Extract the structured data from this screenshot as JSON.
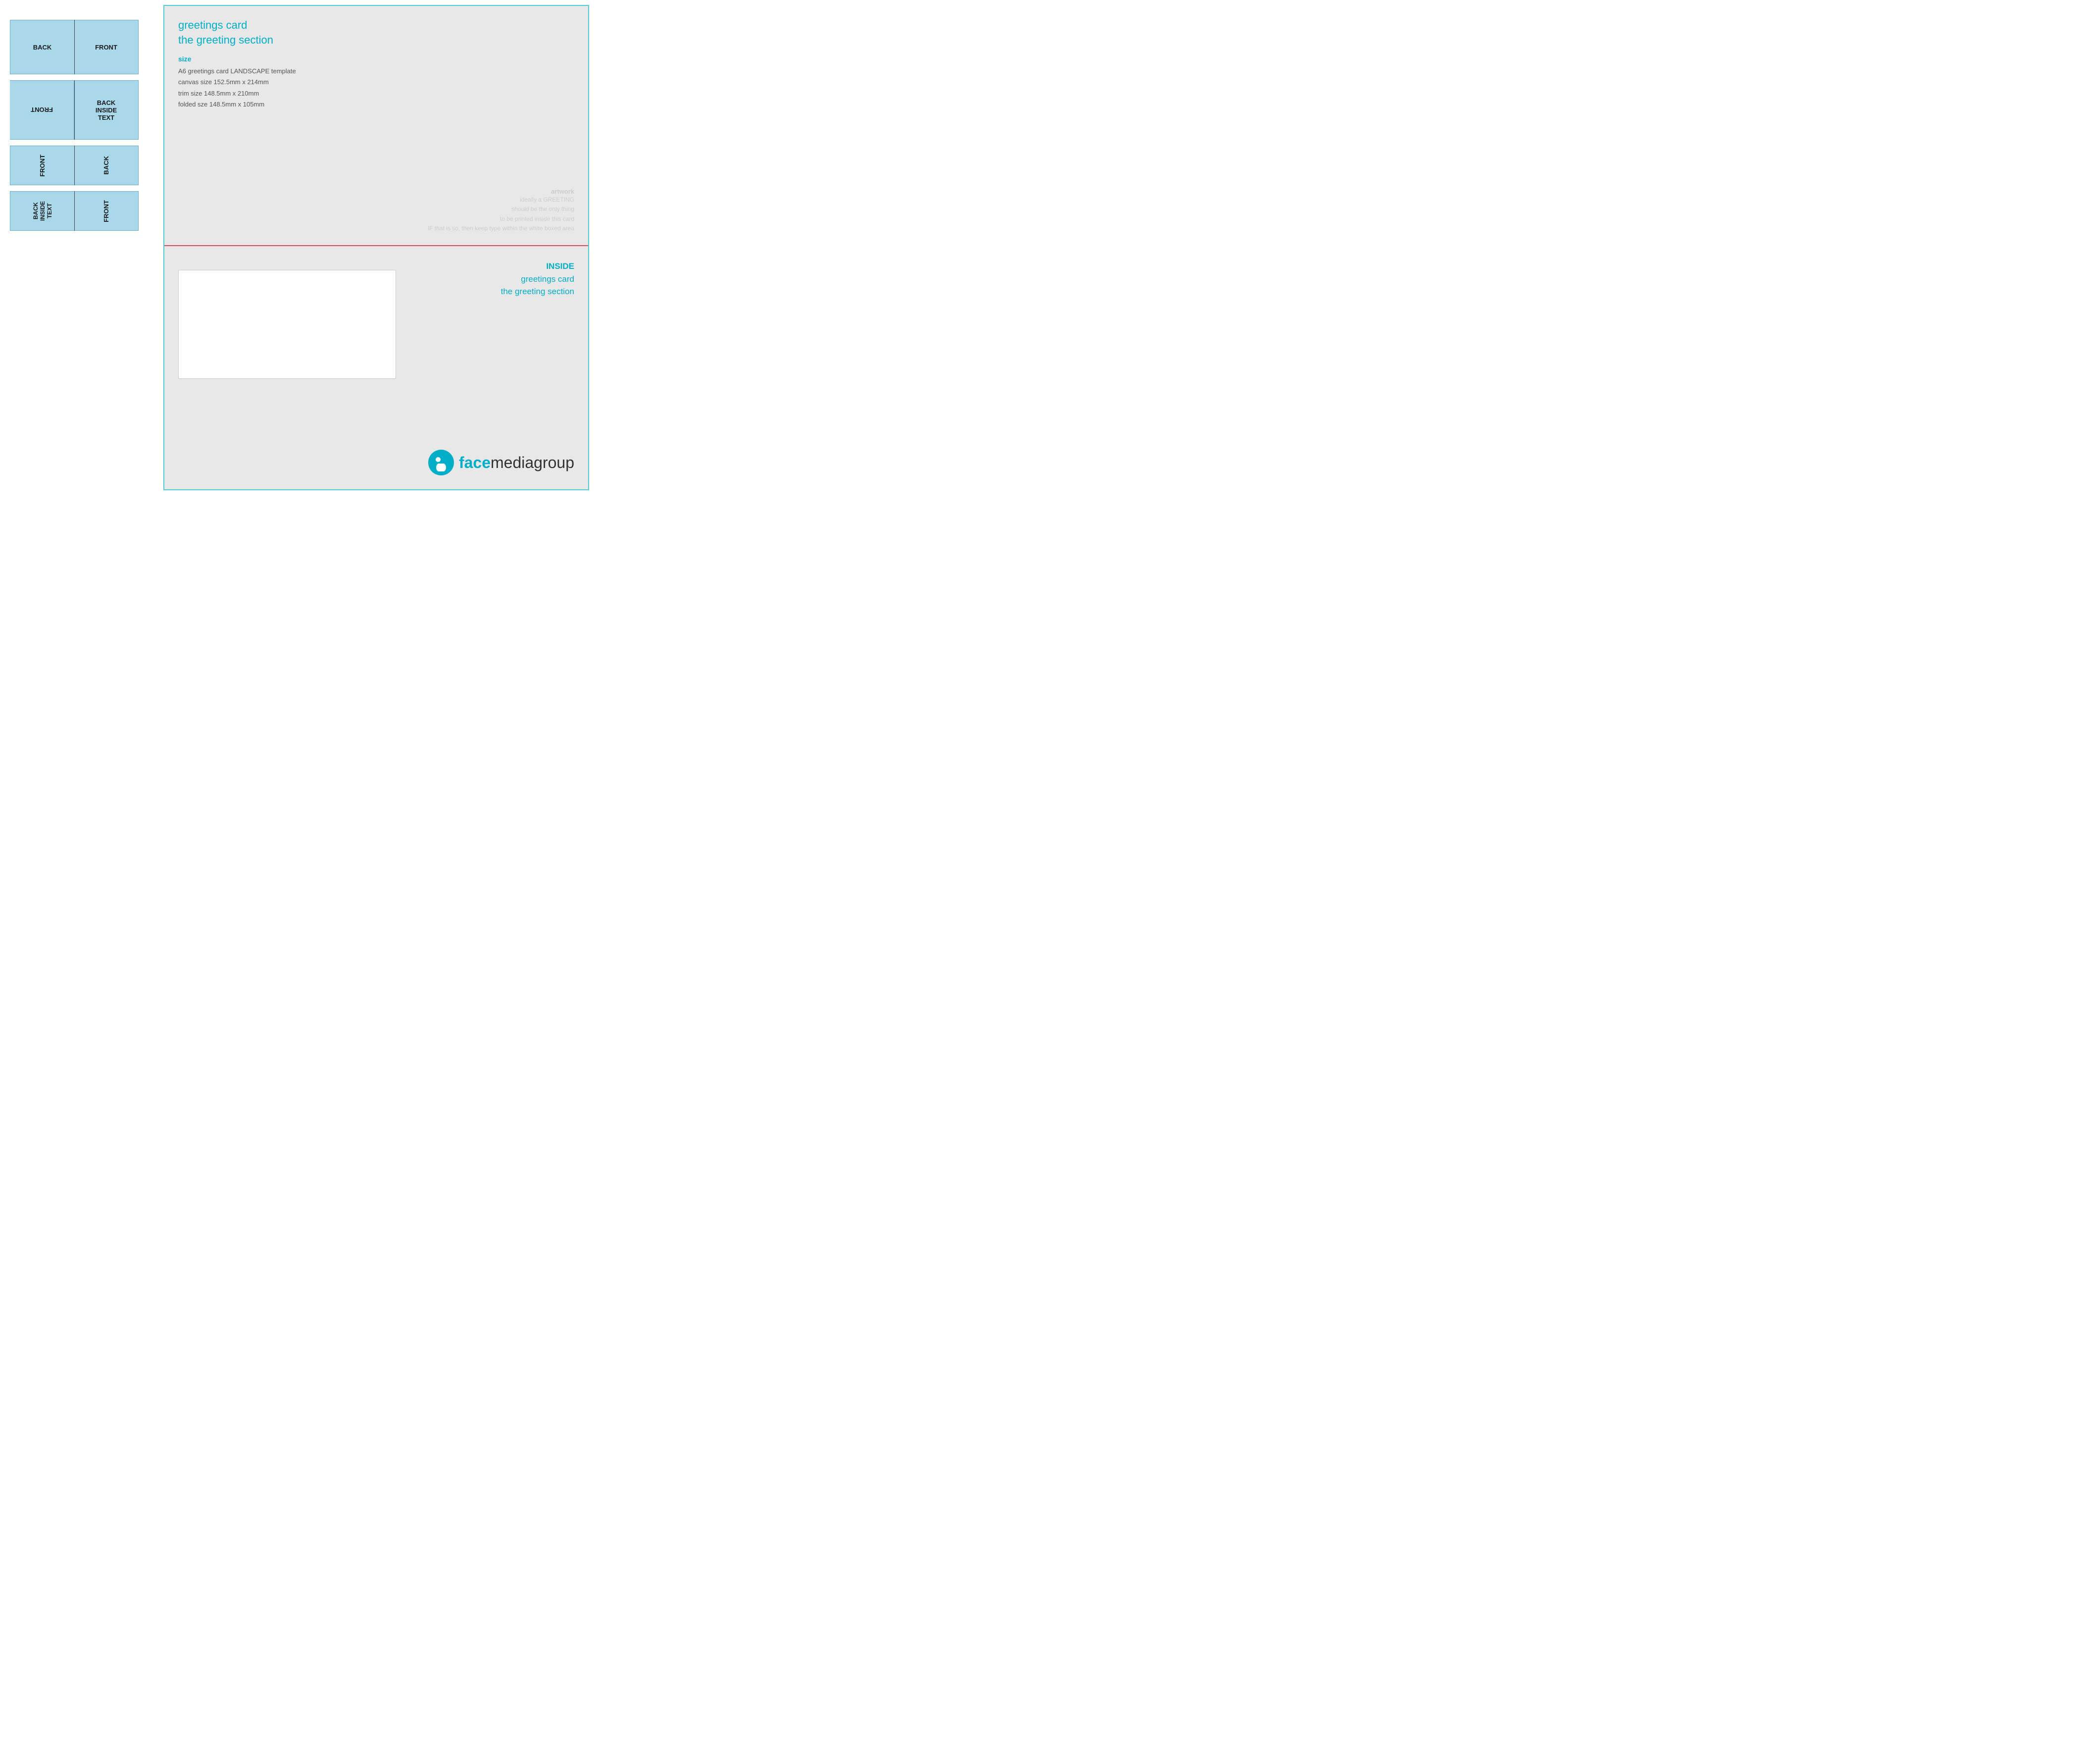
{
  "left": {
    "row1": {
      "cell1": "BACK",
      "cell2": "FRONT"
    },
    "row2": {
      "cell1": "FRONT",
      "cell2_line1": "BACK",
      "cell2_line2": "INSIDE",
      "cell2_line3": "TEXT"
    },
    "row3": {
      "cell1": "FRONT",
      "cell2": "BACK"
    },
    "row4": {
      "cell1_line1": "BACK",
      "cell1_line2": "INSIDE",
      "cell1_line3": "TEXT",
      "cell2": "FRONT"
    }
  },
  "right": {
    "top": {
      "title_line1": "greetings card",
      "title_line2": "the greeting section",
      "size_label": "size",
      "size_line1": "A6 greetings card LANDSCAPE template",
      "size_line2": "canvas size 152.5mm x 214mm",
      "size_line3": "trim size 148.5mm x 210mm",
      "size_line4": "folded sze 148.5mm x 105mm",
      "artwork_label": "artwork",
      "artwork_line1": "ideally a GREETING",
      "artwork_line2": "should be the only thing",
      "artwork_line3": "to be printed inside this card",
      "artwork_line4": "IF that is so, then keep type within the white boxed area"
    },
    "bottom": {
      "inside_label_line1": "INSIDE",
      "inside_label_line2": "greetings card",
      "inside_label_line3": "the greeting section",
      "brand_face": "face",
      "brand_media": "mediagroup"
    }
  }
}
